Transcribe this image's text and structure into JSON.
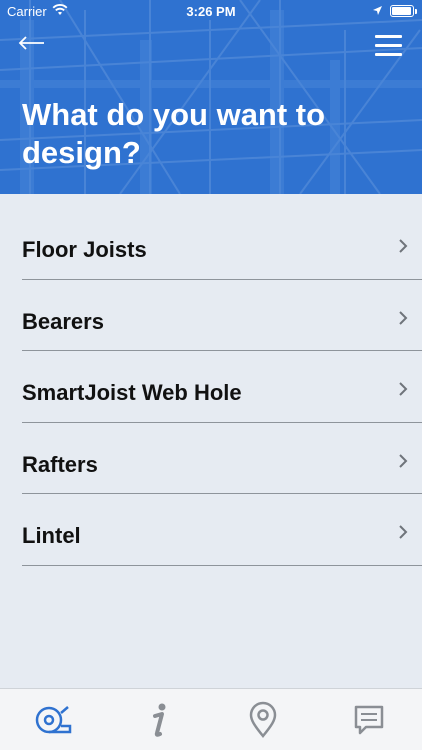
{
  "status_bar": {
    "carrier": "Carrier",
    "time": "3:26 PM",
    "icons": [
      "wifi-icon",
      "location-arrow-icon",
      "battery-icon"
    ]
  },
  "header": {
    "title": "What do you want to design?",
    "back_icon": "arrow-left-icon",
    "menu_icon": "hamburger-menu-icon",
    "color": "#2f72d0"
  },
  "list": {
    "items": [
      {
        "label": "Floor Joists"
      },
      {
        "label": "Bearers"
      },
      {
        "label": "SmartJoist Web Hole"
      },
      {
        "label": "Rafters"
      },
      {
        "label": "Lintel"
      }
    ],
    "chevron_icon": "chevron-right-icon"
  },
  "tab_bar": {
    "tabs": [
      {
        "icon": "tape-measure-icon",
        "active": true
      },
      {
        "icon": "info-icon",
        "active": false
      },
      {
        "icon": "map-pin-icon",
        "active": false
      },
      {
        "icon": "chat-message-icon",
        "active": false
      }
    ],
    "active_color": "#2f72d0",
    "inactive_color": "#8a8e94"
  }
}
